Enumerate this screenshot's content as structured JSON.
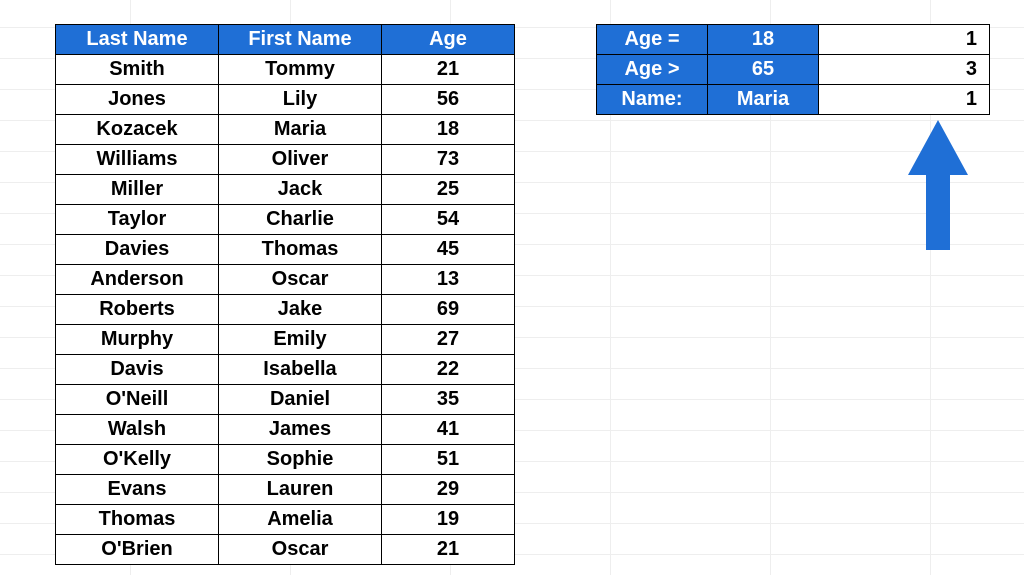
{
  "colors": {
    "accent": "#1f6fd6"
  },
  "table": {
    "headers": {
      "last": "Last Name",
      "first": "First Name",
      "age": "Age"
    },
    "rows": [
      {
        "last": "Smith",
        "first": "Tommy",
        "age": "21"
      },
      {
        "last": "Jones",
        "first": "Lily",
        "age": "56"
      },
      {
        "last": "Kozacek",
        "first": "Maria",
        "age": "18"
      },
      {
        "last": "Williams",
        "first": "Oliver",
        "age": "73"
      },
      {
        "last": "Miller",
        "first": "Jack",
        "age": "25"
      },
      {
        "last": "Taylor",
        "first": "Charlie",
        "age": "54"
      },
      {
        "last": "Davies",
        "first": "Thomas",
        "age": "45"
      },
      {
        "last": "Anderson",
        "first": "Oscar",
        "age": "13"
      },
      {
        "last": "Roberts",
        "first": "Jake",
        "age": "69"
      },
      {
        "last": "Murphy",
        "first": "Emily",
        "age": "27"
      },
      {
        "last": "Davis",
        "first": "Isabella",
        "age": "22"
      },
      {
        "last": "O'Neill",
        "first": "Daniel",
        "age": "35"
      },
      {
        "last": "Walsh",
        "first": "James",
        "age": "41"
      },
      {
        "last": "O'Kelly",
        "first": "Sophie",
        "age": "51"
      },
      {
        "last": "Evans",
        "first": "Lauren",
        "age": "29"
      },
      {
        "last": "Thomas",
        "first": "Amelia",
        "age": "19"
      },
      {
        "last": "O'Brien",
        "first": "Oscar",
        "age": "21"
      }
    ]
  },
  "criteria": {
    "rows": [
      {
        "label": "Age =",
        "value": "18",
        "result": "1"
      },
      {
        "label": "Age >",
        "value": "65",
        "result": "3"
      },
      {
        "label": "Name:",
        "value": "Maria",
        "result": "1"
      }
    ]
  }
}
